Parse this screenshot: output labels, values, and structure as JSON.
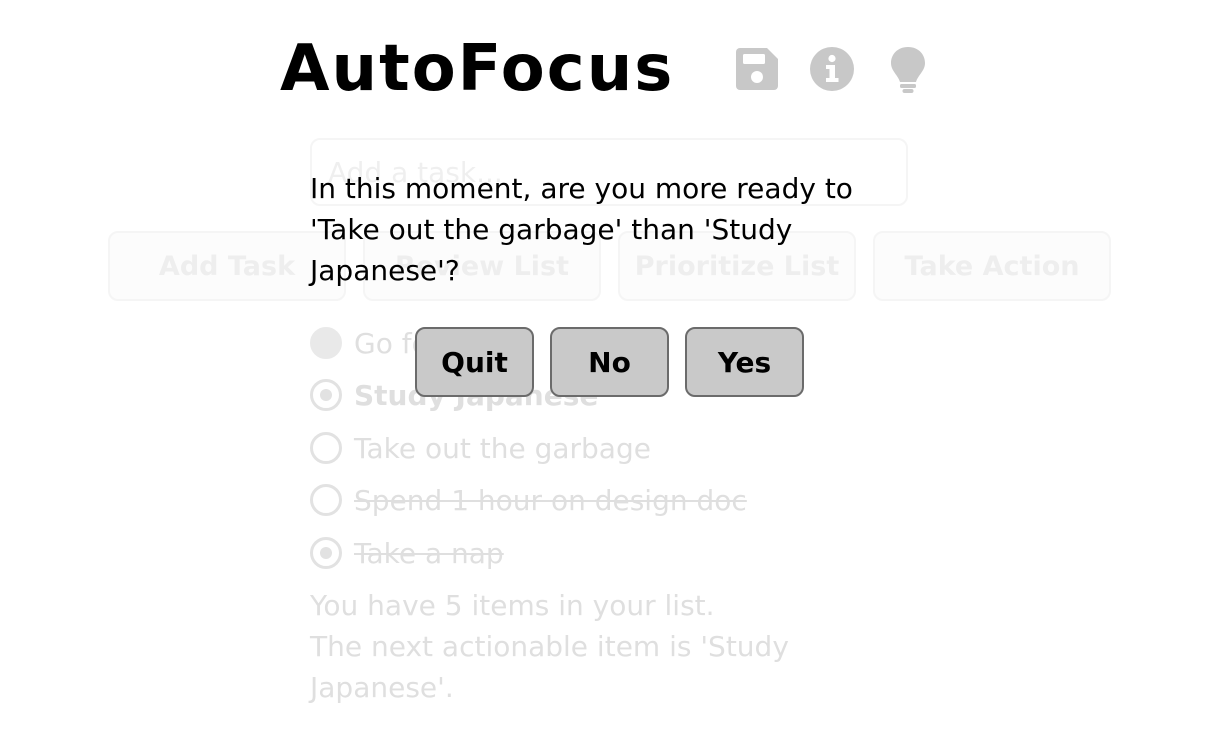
{
  "app": {
    "title": "AutoFocus"
  },
  "header_icons": [
    {
      "name": "save-icon",
      "color": "#c8c8c8"
    },
    {
      "name": "info-icon",
      "color": "#c8c8c8"
    },
    {
      "name": "lightbulb-icon",
      "color": "#c8c8c8"
    }
  ],
  "input": {
    "placeholder": "Add a task...",
    "value": ""
  },
  "actions": {
    "add": "Add Task",
    "review": "Review List",
    "prioritize": "Prioritize List",
    "take_action": "Take Action"
  },
  "tasks": [
    {
      "label": "Go for a run",
      "state": "done-filled",
      "style": "normal"
    },
    {
      "label": "Study Japanese",
      "state": "dotted",
      "style": "bold"
    },
    {
      "label": "Take out the garbage",
      "state": "empty",
      "style": "normal"
    },
    {
      "label": "Spend 1 hour on design doc",
      "state": "empty",
      "style": "strike"
    },
    {
      "label": "Take a nap",
      "state": "dotted",
      "style": "strike"
    }
  ],
  "summary": {
    "line1": "You have 5 items in your list.",
    "line2": "The next actionable item is 'Study Japanese'."
  },
  "modal": {
    "question": "In this moment, are you more ready to 'Take out the garbage' than 'Study Japanese'?",
    "quit": "Quit",
    "no": "No",
    "yes": "Yes"
  },
  "colors": {
    "icon_gray": "#c8c8c8",
    "modal_button_bg": "#c9c9c9",
    "modal_button_border": "#6b6b6b"
  }
}
